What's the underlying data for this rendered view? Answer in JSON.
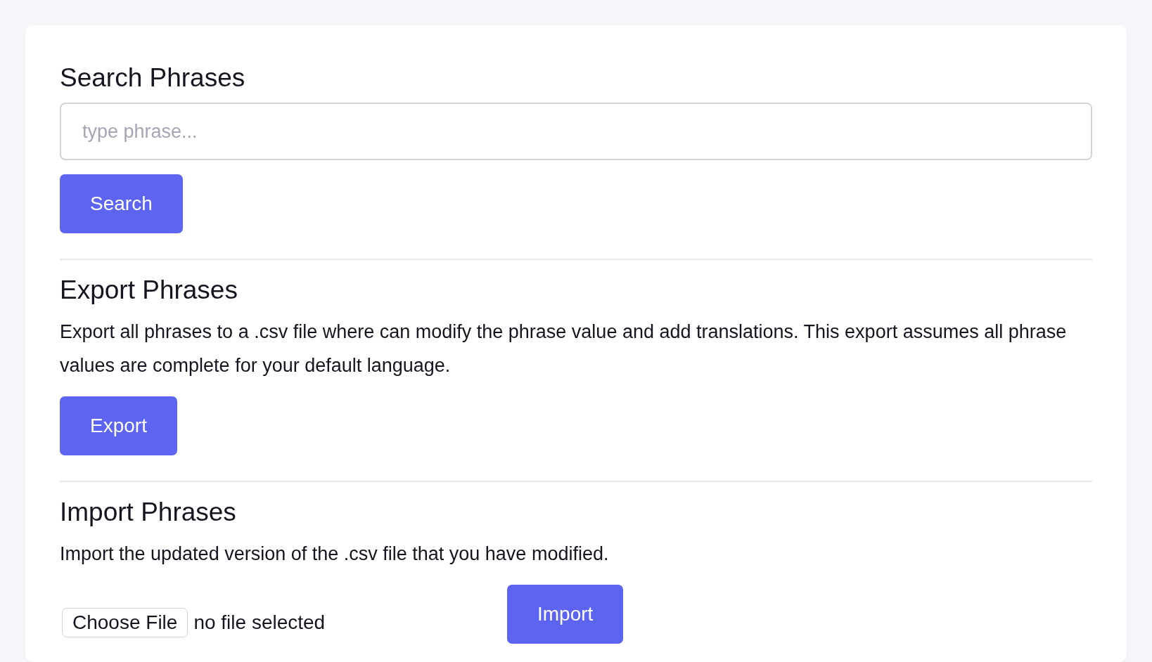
{
  "sections": [
    {
      "kind": "search",
      "title": "Search Phrases",
      "field": {
        "placeholder": "type phrase..."
      },
      "button": "Search"
    },
    {
      "kind": "export",
      "title": "Export Phrases",
      "description": "Export all phrases to a .csv file where can modify the phrase value and add translations. This export assumes all phrase values are complete for your default language.",
      "button": "Export"
    },
    {
      "kind": "import",
      "title": "Import Phrases",
      "description": "Import the updated version of the .csv file that you have modified.",
      "file_button": "Choose File",
      "file_status": "no file selected",
      "button": "Import"
    }
  ]
}
